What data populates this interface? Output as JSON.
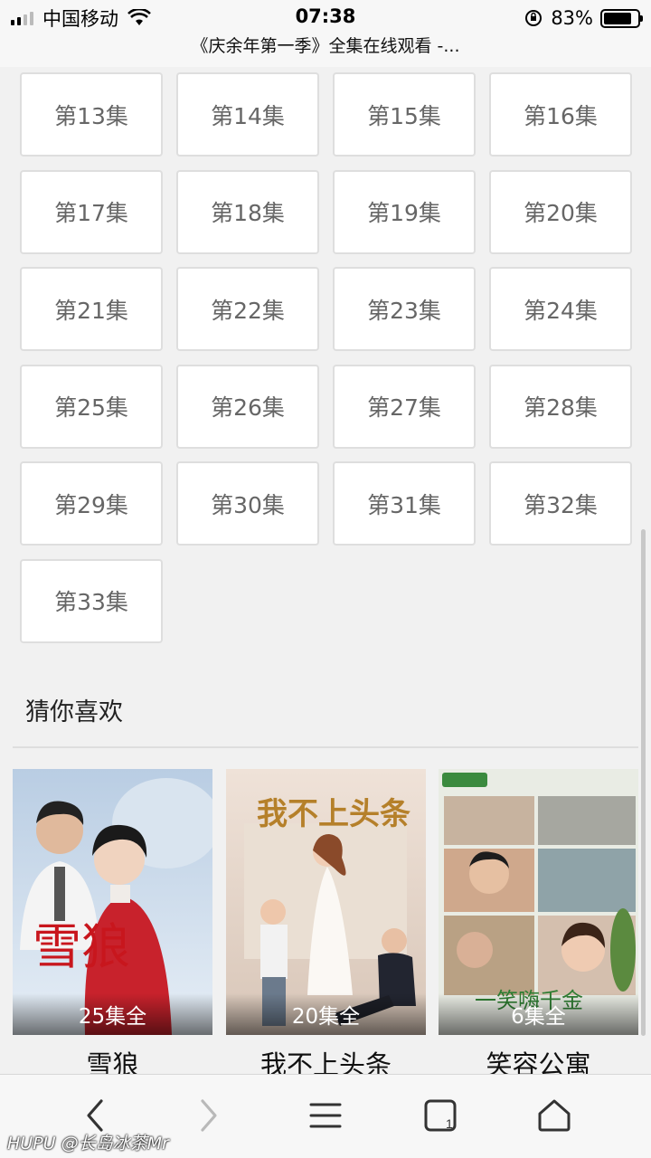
{
  "status": {
    "carrier": "中国移动",
    "time": "07:38",
    "battery": "83%",
    "battery_level": 0.83
  },
  "page_title": "《庆余年第一季》全集在线观看 -...",
  "episodes": [
    "第13集",
    "第14集",
    "第15集",
    "第16集",
    "第17集",
    "第18集",
    "第19集",
    "第20集",
    "第21集",
    "第22集",
    "第23集",
    "第24集",
    "第25集",
    "第26集",
    "第27集",
    "第28集",
    "第29集",
    "第30集",
    "第31集",
    "第32集",
    "第33集"
  ],
  "recommend": {
    "heading": "猜你喜欢",
    "items": [
      {
        "title": "雪狼",
        "badge": "25集全",
        "poster_text": "雪狼"
      },
      {
        "title": "我不上头条",
        "badge": "20集全",
        "poster_text": "我不上头条"
      },
      {
        "title": "笑容公寓",
        "badge": "6集全",
        "poster_text": "一笑嗨千金"
      }
    ]
  },
  "toolbar": {
    "icons": [
      "back-icon",
      "forward-icon",
      "menu-icon",
      "tabs-icon",
      "home-icon"
    ]
  },
  "watermark": "HUPU @长岛冰茶Mr"
}
